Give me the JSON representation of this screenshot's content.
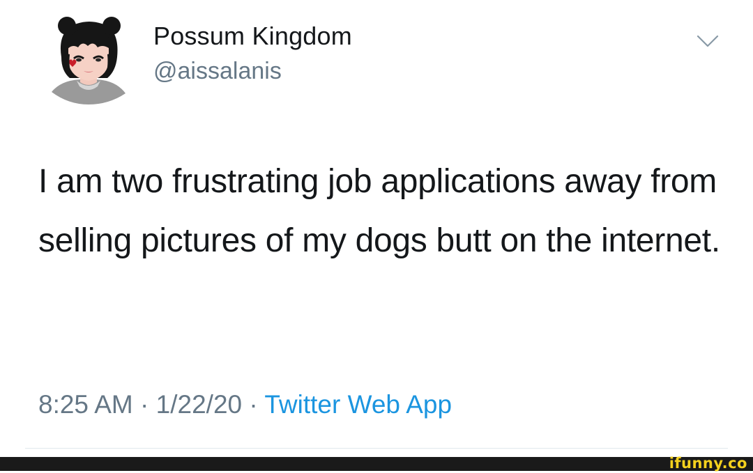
{
  "user": {
    "display_name": "Possum Kingdom",
    "handle": "@aissalanis"
  },
  "tweet": {
    "text": "I am two frustrating job applications away from selling pictures of my dogs butt on the internet."
  },
  "meta": {
    "time": "8:25 AM",
    "separator_1": " · ",
    "date": "1/22/20",
    "separator_2": " · ",
    "source": "Twitter Web App"
  },
  "icons": {
    "menu": "chevron-down-icon"
  },
  "watermark": {
    "text": "ifunny.co"
  },
  "colors": {
    "text": "#14171a",
    "secondary": "#657786",
    "link": "#1b95e0",
    "watermark": "#f4d11e"
  }
}
